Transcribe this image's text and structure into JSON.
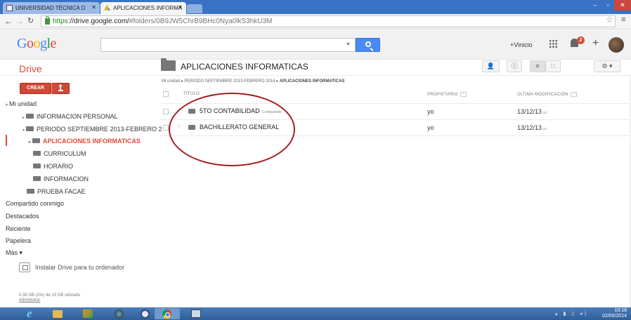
{
  "browser": {
    "tabs": [
      {
        "label": "UNIVERSIDAD TÉCNICA D",
        "active": false
      },
      {
        "label": "APLICACIONES INFORMA",
        "active": true
      }
    ],
    "url_https": "https",
    "url_domain": "://drive.google.com/",
    "url_path": "#folders/0B9JW5ChrB9BHc0Nya0lkS3hkU3M"
  },
  "google_bar": {
    "logo_letters": [
      "G",
      "o",
      "o",
      "g",
      "l",
      "e"
    ],
    "logo_colors": [
      "#4285f4",
      "#db4437",
      "#f4b400",
      "#4285f4",
      "#0f9d58",
      "#db4437"
    ],
    "user_name": "+Vinicio",
    "notification_count": "2"
  },
  "drive": {
    "title": "Drive",
    "folder_title": "APLICACIONES INFORMATICAS",
    "create_label": "CREAR"
  },
  "sidebar": {
    "my_drive": "Mi unidad",
    "tree": [
      {
        "label": "INFORMACION PERSONAL"
      },
      {
        "label": "PERIODO SEPTIEMBRE 2013-FEBRERO 2"
      },
      {
        "label": "APLICACIONES INFORMATICAS"
      },
      {
        "label": "CURRICULUM"
      },
      {
        "label": "HORARIO"
      },
      {
        "label": "INFORMACION"
      },
      {
        "label": "PRUEBA FACAE"
      }
    ],
    "links": [
      "Compartido conmigo",
      "Destacados",
      "Reciente",
      "Papelera",
      "Más"
    ],
    "install_label": "Instalar Drive para tu ordenador",
    "storage_text": "0,36 GB (2%) de 15 GB utilizado",
    "manage_label": "Administrar"
  },
  "list": {
    "breadcrumb": [
      "Mi unidad",
      "PERIODO SEPTIEMBRE 2013-FEBRERO 2014",
      "APLICACIONES INFORMATICAS"
    ],
    "columns": {
      "title": "TÍTULO",
      "owner": "PROPIETARIO",
      "modified": "ÚLTIMA MODIFICACIÓN"
    },
    "rows": [
      {
        "name": "5TO CONTABILIDAD",
        "tag": "Compartido",
        "owner": "yo",
        "date": "13/12/13",
        "date_suffix": "yo"
      },
      {
        "name": "BACHILLERATO GENERAL",
        "tag": "",
        "owner": "yo",
        "date": "13/12/13",
        "date_suffix": "yo"
      }
    ]
  },
  "taskbar": {
    "time": "10:18",
    "date": "02/05/2014"
  },
  "colors": {
    "drive_red": "#dd4b39",
    "annotation": "#a51c1c",
    "taskbar": "#3a6aa8"
  }
}
